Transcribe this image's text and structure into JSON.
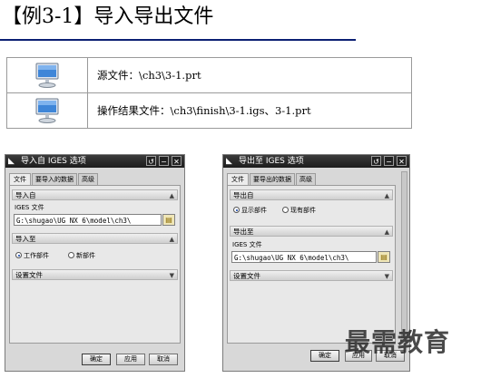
{
  "header": {
    "title": "【例3-1】导入导出文件"
  },
  "info_rows": [
    {
      "icon": "monitor-icon",
      "text": "源文件：\\ch3\\3-1.prt"
    },
    {
      "icon": "monitor-icon",
      "text": "操作结果文件：\\ch3\\finish\\3-1.igs、3-1.prt"
    }
  ],
  "import_dialog": {
    "title": "导入自 IGES 选项",
    "titlebar_buttons": [
      "↺",
      "−",
      "✕"
    ],
    "tabs": [
      "文件",
      "要导入的数据",
      "高级"
    ],
    "section_import_from": "导入自",
    "field_label": "IGES 文件",
    "path_value": "G:\\shugao\\UG NX 6\\model\\ch3\\",
    "section_import_to": "导入至",
    "radio_work_part": "工作部件",
    "radio_new_part": "新部件",
    "section_settings": "设置文件",
    "btn_ok": "确定",
    "btn_apply": "应用",
    "btn_cancel": "取消"
  },
  "export_dialog": {
    "title": "导出至 IGES 选项",
    "titlebar_buttons": [
      "↺",
      "−",
      "✕"
    ],
    "tabs": [
      "文件",
      "要导出的数据",
      "高级"
    ],
    "section_export_from": "导出自",
    "radio_displayed_part": "显示部件",
    "radio_existing_part": "现有部件",
    "section_export_to": "导出至",
    "field_label": "IGES 文件",
    "path_value": "G:\\shugao\\UG NX 6\\model\\ch3\\",
    "section_settings": "设置文件",
    "btn_ok": "确定",
    "btn_apply": "应用",
    "btn_cancel": "取消"
  },
  "watermark": "最需教育"
}
